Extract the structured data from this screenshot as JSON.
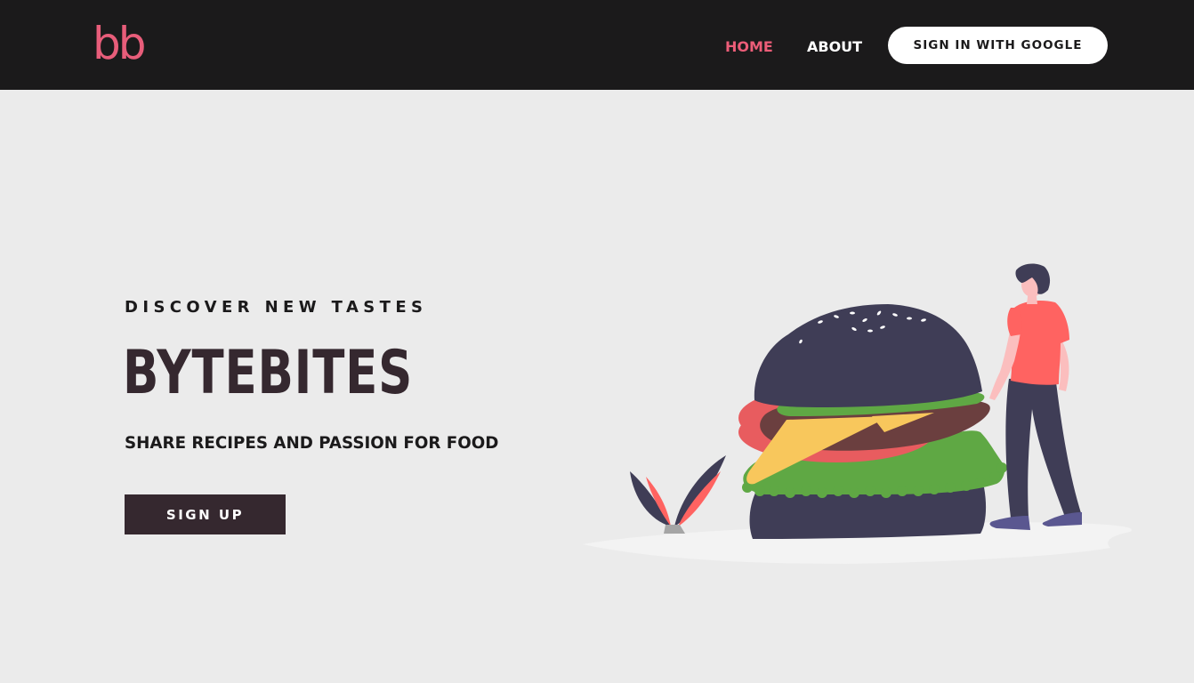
{
  "header": {
    "logo_text": "bb",
    "nav": {
      "home": "HOME",
      "about": "ABOUT"
    },
    "sign_in_label": "SIGN IN WITH GOOGLE"
  },
  "hero": {
    "eyebrow": "DISCOVER NEW TASTES",
    "title": "BYTEBITES",
    "subtitle": "SHARE RECIPES AND PASSION FOR FOOD",
    "signup_label": "SIGN UP"
  },
  "colors": {
    "nav_background": "#1b1a1b",
    "accent": "#ec5d78",
    "page_background": "#ebebeb",
    "title_color": "#35282f",
    "button_dark": "#35282f"
  },
  "icons": {
    "illustration": "burger-person-illustration"
  }
}
